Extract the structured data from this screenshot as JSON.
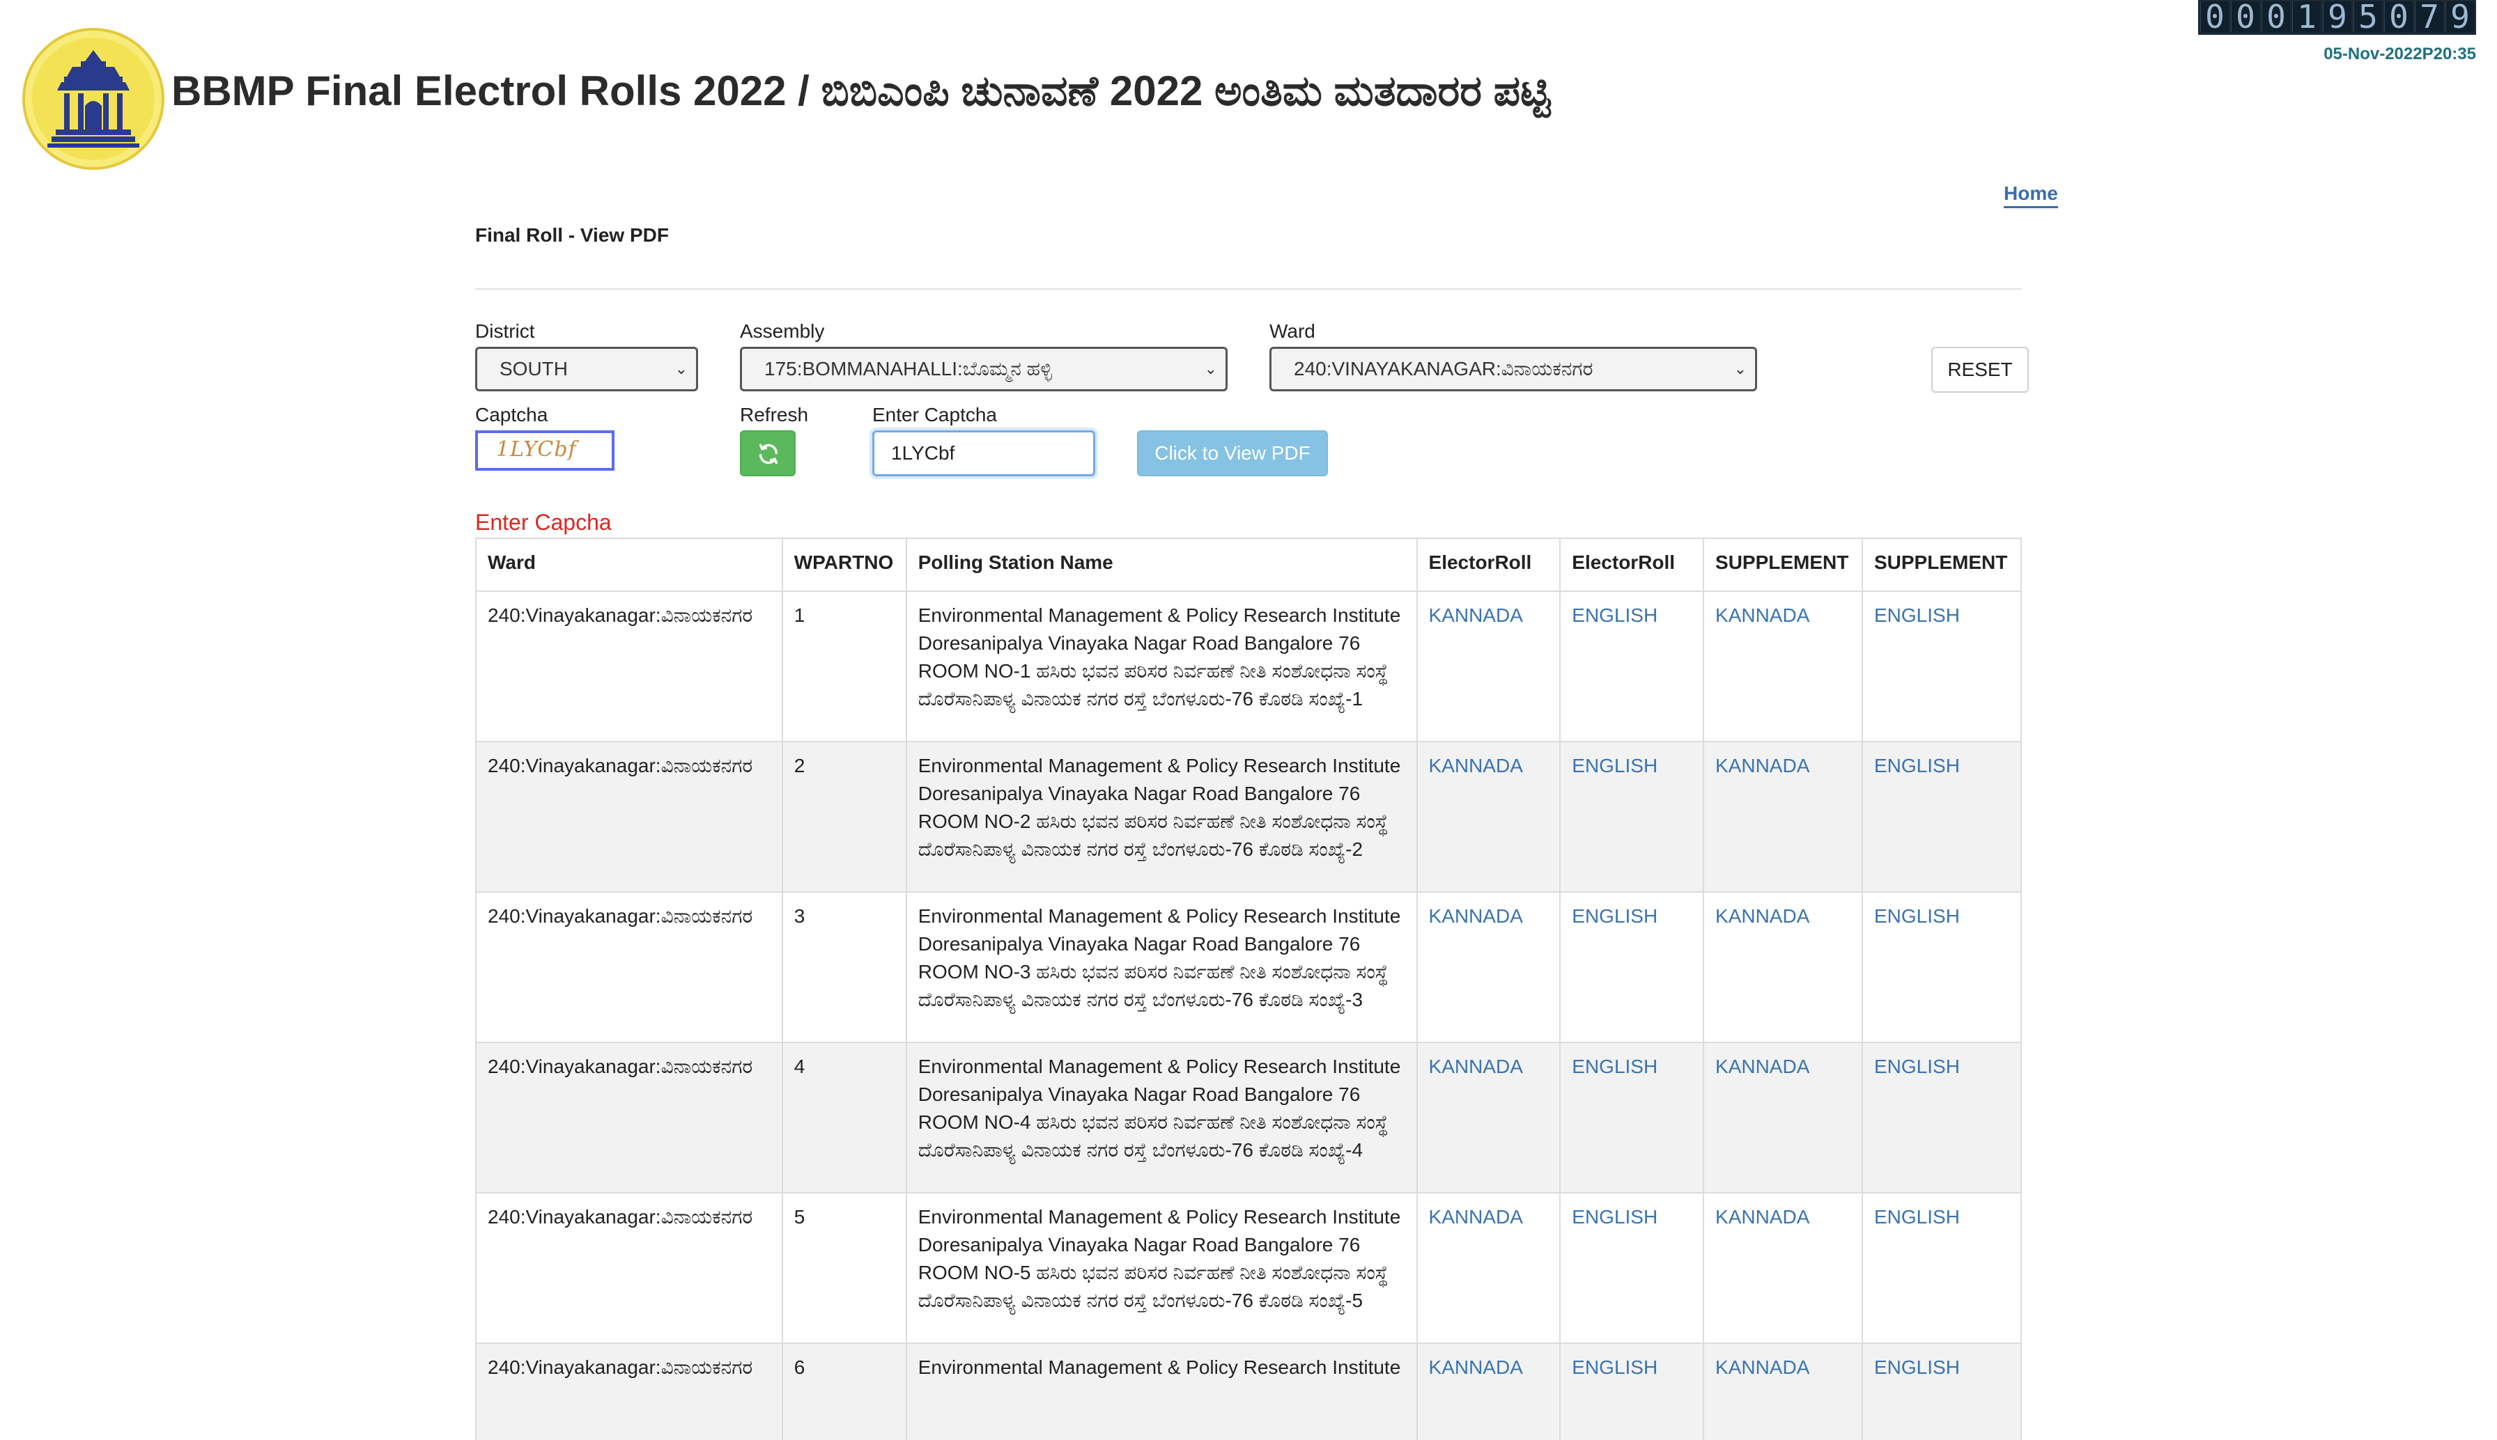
{
  "header": {
    "title": "BBMP Final Electrol Rolls 2022 / ಬಿಬಿಎಂಪಿ ಚುನಾವಣೆ 2022 ಅಂತಿಮ ಮತದಾರರ ಪಟ್ಟಿ",
    "counter_digits": [
      "0",
      "0",
      "0",
      "1",
      "9",
      "5",
      "0",
      "7",
      "9"
    ],
    "datetime": "05-Nov-2022P20:35",
    "home_link": "Home",
    "logo_icon": "bbmp-emblem-icon"
  },
  "page": {
    "subtitle": "Final Roll - View PDF"
  },
  "form": {
    "district": {
      "label": "District",
      "value": "SOUTH"
    },
    "assembly": {
      "label": "Assembly",
      "value": "175:BOMMANAHALLI:ಬೊಮ್ಮನ ಹಳ್ಳಿ"
    },
    "ward": {
      "label": "Ward",
      "value": "240:VINAYAKANAGAR:ವಿನಾಯಕನಗರ"
    },
    "reset_label": "RESET",
    "captcha_label": "Captcha",
    "captcha_image_text": "1LYCbf",
    "refresh_label": "Refresh",
    "enter_captcha_label": "Enter Captcha",
    "enter_captcha_value": "1LYCbf",
    "view_pdf_label": "Click to View PDF",
    "error_message": "Enter Capcha"
  },
  "table": {
    "headers": [
      "Ward",
      "WPARTNO",
      "Polling Station Name",
      "ElectorRoll",
      "ElectorRoll",
      "SUPPLEMENT",
      "SUPPLEMENT"
    ],
    "rows": [
      {
        "ward": "240:Vinayakanagar:ವಿನಾಯಕನಗರ",
        "partno": "1",
        "station": "Environmental Management & Policy Research Institute Doresanipalya Vinayaka Nagar Road Bangalore 76 ROOM NO-1 ಹಸಿರು ಭವನ ಪರಿಸರ ನಿರ್ವಹಣೆ ನೀತಿ ಸಂಶೋಧನಾ ಸಂಸ್ಥೆ ದೊರೆಸಾನಿಪಾಳ್ಯ ವಿನಾಯಕ ನಗರ ರಸ್ತೆ ಬೆಂಗಳೂರು-76 ಕೊಠಡಿ ಸಂಖ್ಯೆ-1",
        "e_kannada": "KANNADA",
        "e_english": "ENGLISH",
        "s_kannada": "KANNADA",
        "s_english": "ENGLISH"
      },
      {
        "ward": "240:Vinayakanagar:ವಿನಾಯಕನಗರ",
        "partno": "2",
        "station": "Environmental Management & Policy Research Institute Doresanipalya Vinayaka Nagar Road Bangalore 76 ROOM NO-2 ಹಸಿರು ಭವನ ಪರಿಸರ ನಿರ್ವಹಣೆ ನೀತಿ ಸಂಶೋಧನಾ ಸಂಸ್ಥೆ ದೊರೆಸಾನಿಪಾಳ್ಯ ವಿನಾಯಕ ನಗರ ರಸ್ತೆ ಬೆಂಗಳೂರು-76 ಕೊಠಡಿ ಸಂಖ್ಯೆ-2",
        "e_kannada": "KANNADA",
        "e_english": "ENGLISH",
        "s_kannada": "KANNADA",
        "s_english": "ENGLISH"
      },
      {
        "ward": "240:Vinayakanagar:ವಿನಾಯಕನಗರ",
        "partno": "3",
        "station": "Environmental Management & Policy Research Institute Doresanipalya Vinayaka Nagar Road Bangalore 76 ROOM NO-3 ಹಸಿರು ಭವನ ಪರಿಸರ ನಿರ್ವಹಣೆ ನೀತಿ ಸಂಶೋಧನಾ ಸಂಸ್ಥೆ ದೊರೆಸಾನಿಪಾಳ್ಯ ವಿನಾಯಕ ನಗರ ರಸ್ತೆ ಬೆಂಗಳೂರು-76 ಕೊಠಡಿ ಸಂಖ್ಯೆ-3",
        "e_kannada": "KANNADA",
        "e_english": "ENGLISH",
        "s_kannada": "KANNADA",
        "s_english": "ENGLISH"
      },
      {
        "ward": "240:Vinayakanagar:ವಿನಾಯಕನಗರ",
        "partno": "4",
        "station": "Environmental Management & Policy Research Institute Doresanipalya Vinayaka Nagar Road Bangalore 76 ROOM NO-4 ಹಸಿರು ಭವನ ಪರಿಸರ ನಿರ್ವಹಣೆ ನೀತಿ ಸಂಶೋಧನಾ ಸಂಸ್ಥೆ ದೊರೆಸಾನಿಪಾಳ್ಯ ವಿನಾಯಕ ನಗರ ರಸ್ತೆ ಬೆಂಗಳೂರು-76 ಕೊಠಡಿ ಸಂಖ್ಯೆ-4",
        "e_kannada": "KANNADA",
        "e_english": "ENGLISH",
        "s_kannada": "KANNADA",
        "s_english": "ENGLISH"
      },
      {
        "ward": "240:Vinayakanagar:ವಿನಾಯಕನಗರ",
        "partno": "5",
        "station": "Environmental Management & Policy Research Institute Doresanipalya Vinayaka Nagar Road Bangalore 76 ROOM NO-5 ಹಸಿರು ಭವನ ಪರಿಸರ ನಿರ್ವಹಣೆ ನೀತಿ ಸಂಶೋಧನಾ ಸಂಸ್ಥೆ ದೊರೆಸಾನಿಪಾಳ್ಯ ವಿನಾಯಕ ನಗರ ರಸ್ತೆ ಬೆಂಗಳೂರು-76 ಕೊಠಡಿ ಸಂಖ್ಯೆ-5",
        "e_kannada": "KANNADA",
        "e_english": "ENGLISH",
        "s_kannada": "KANNADA",
        "s_english": "ENGLISH"
      },
      {
        "ward": "240:Vinayakanagar:ವಿನಾಯಕನಗರ",
        "partno": "6",
        "station": "Environmental Management & Policy Research Institute",
        "e_kannada": "KANNADA",
        "e_english": "ENGLISH",
        "s_kannada": "KANNADA",
        "s_english": "ENGLISH"
      }
    ]
  },
  "colors": {
    "link": "#3a73b0",
    "error": "#e0261f",
    "refresh_button": "#5cb85c",
    "view_button": "#86c2e3",
    "datetime": "#1e7080"
  }
}
